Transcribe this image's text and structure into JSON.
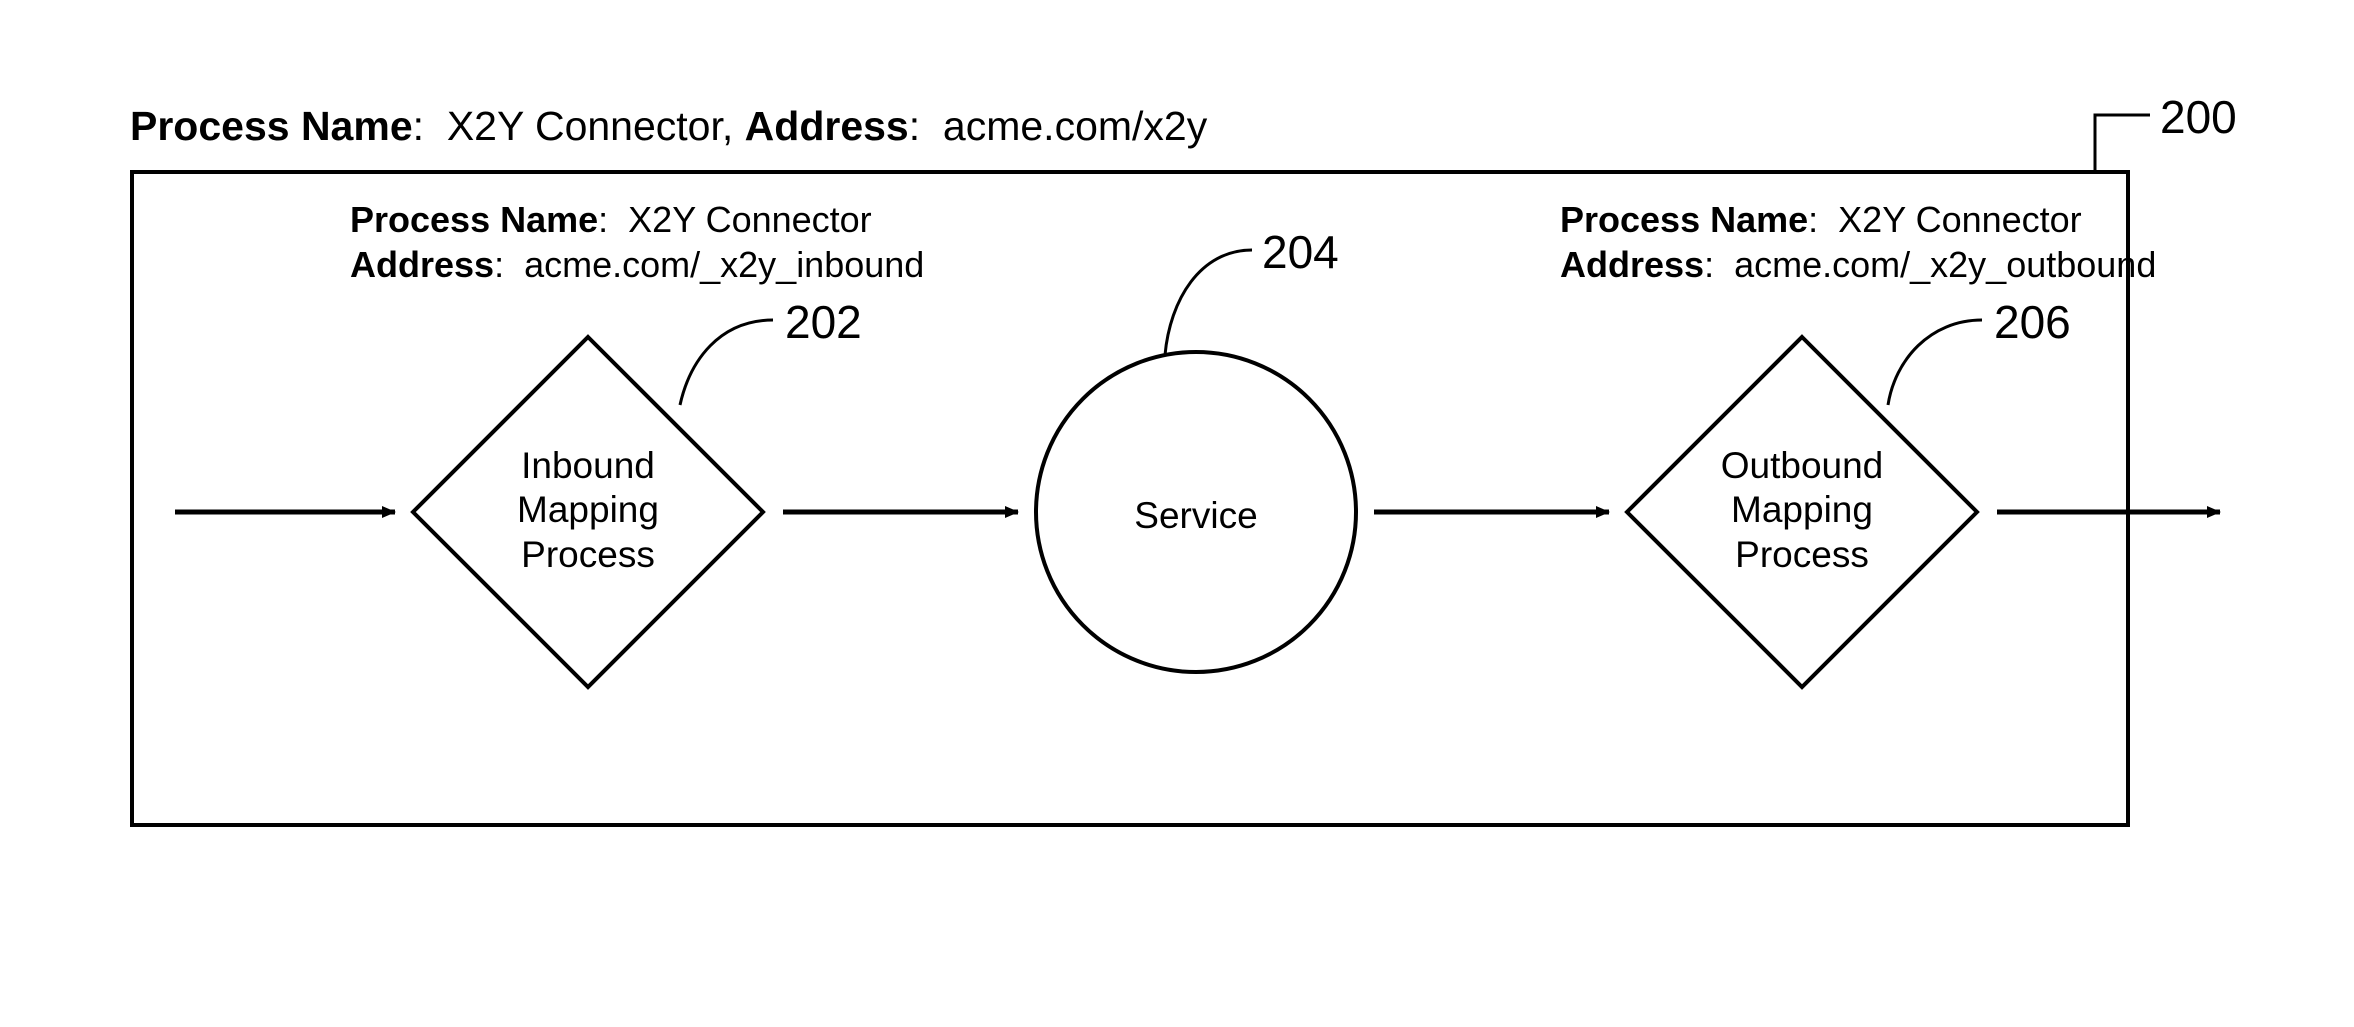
{
  "header": {
    "process_name_label": "Process Name",
    "process_name_value": "X2Y Connector",
    "address_label": "Address",
    "address_value": "acme.com/x2y"
  },
  "callouts": {
    "c200": "200",
    "c202": "202",
    "c204": "204",
    "c206": "206"
  },
  "inbound": {
    "process_name_label": "Process Name",
    "process_name_value": "X2Y Connector",
    "address_label": "Address",
    "address_value": "acme.com/_x2y_inbound",
    "shape_line1": "Inbound",
    "shape_line2": "Mapping",
    "shape_line3": "Process"
  },
  "service": {
    "label": "Service"
  },
  "outbound": {
    "process_name_label": "Process Name",
    "process_name_value": "X2Y Connector",
    "address_label": "Address",
    "address_value": "acme.com/_x2y_outbound",
    "shape_line1": "Outbound",
    "shape_line2": "Mapping",
    "shape_line3": "Process"
  }
}
